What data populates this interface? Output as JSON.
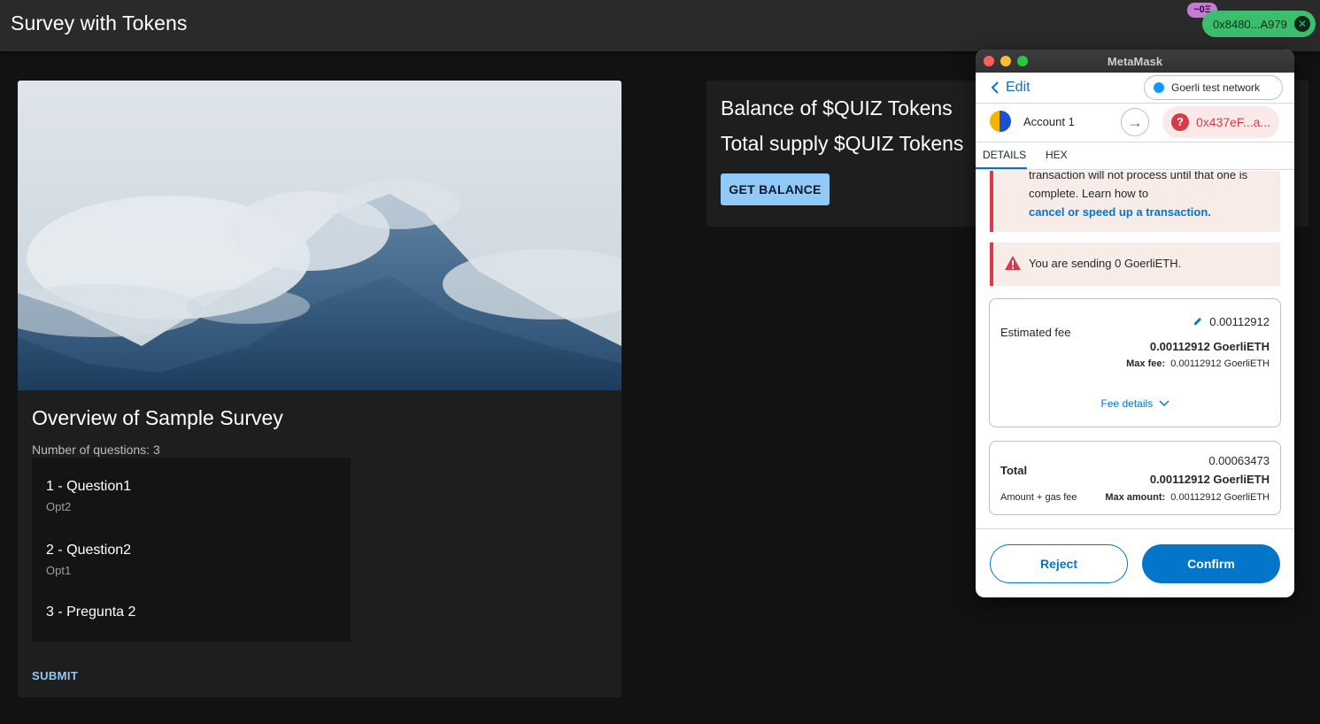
{
  "app": {
    "title": "Survey with Tokens",
    "wallet_address": "0x8480...A979",
    "eth_badge": "~0Ξ"
  },
  "survey": {
    "title": "Overview of Sample Survey",
    "question_count": "Number of questions: 3",
    "questions": [
      {
        "title": "1 - Question1",
        "answer": "Opt2"
      },
      {
        "title": "2 - Question2",
        "answer": "Opt1"
      },
      {
        "title": "3 - Pregunta 2",
        "answer": ""
      }
    ],
    "submit_label": "SUBMIT"
  },
  "balance": {
    "balance_line": "Balance of $QUIZ Tokens",
    "supply_line": "Total supply $QUIZ Tokens",
    "button_label": "GET BALANCE"
  },
  "metamask": {
    "window_title": "MetaMask",
    "edit_label": "Edit",
    "network": "Goerli test network",
    "account_name": "Account 1",
    "recipient": "0x437eF...a...",
    "tabs": [
      "DETAILS",
      "HEX"
    ],
    "notice_text": "transaction will not process until that one is complete. Learn how to",
    "notice_link": "cancel or speed up a transaction.",
    "warning_text": "You are sending 0 GoerliETH.",
    "fee": {
      "label": "Estimated fee",
      "value": "0.00112912",
      "value_eth": "0.00112912 GoerliETH",
      "max_label": "Max fee:",
      "max_value": "0.00112912 GoerliETH",
      "details_label": "Fee details"
    },
    "total": {
      "label": "Total",
      "value": "0.00063473",
      "value_eth": "0.00112912 GoerliETH",
      "sub_label": "Amount + gas fee",
      "max_label": "Max amount:",
      "max_value": "0.00112912 GoerliETH"
    },
    "reject_label": "Reject",
    "confirm_label": "Confirm"
  },
  "colors": {
    "accent_blue": "#0376c9",
    "app_button": "#90caf9",
    "wallet_green": "#3dbd6e",
    "danger": "#d73a49"
  }
}
